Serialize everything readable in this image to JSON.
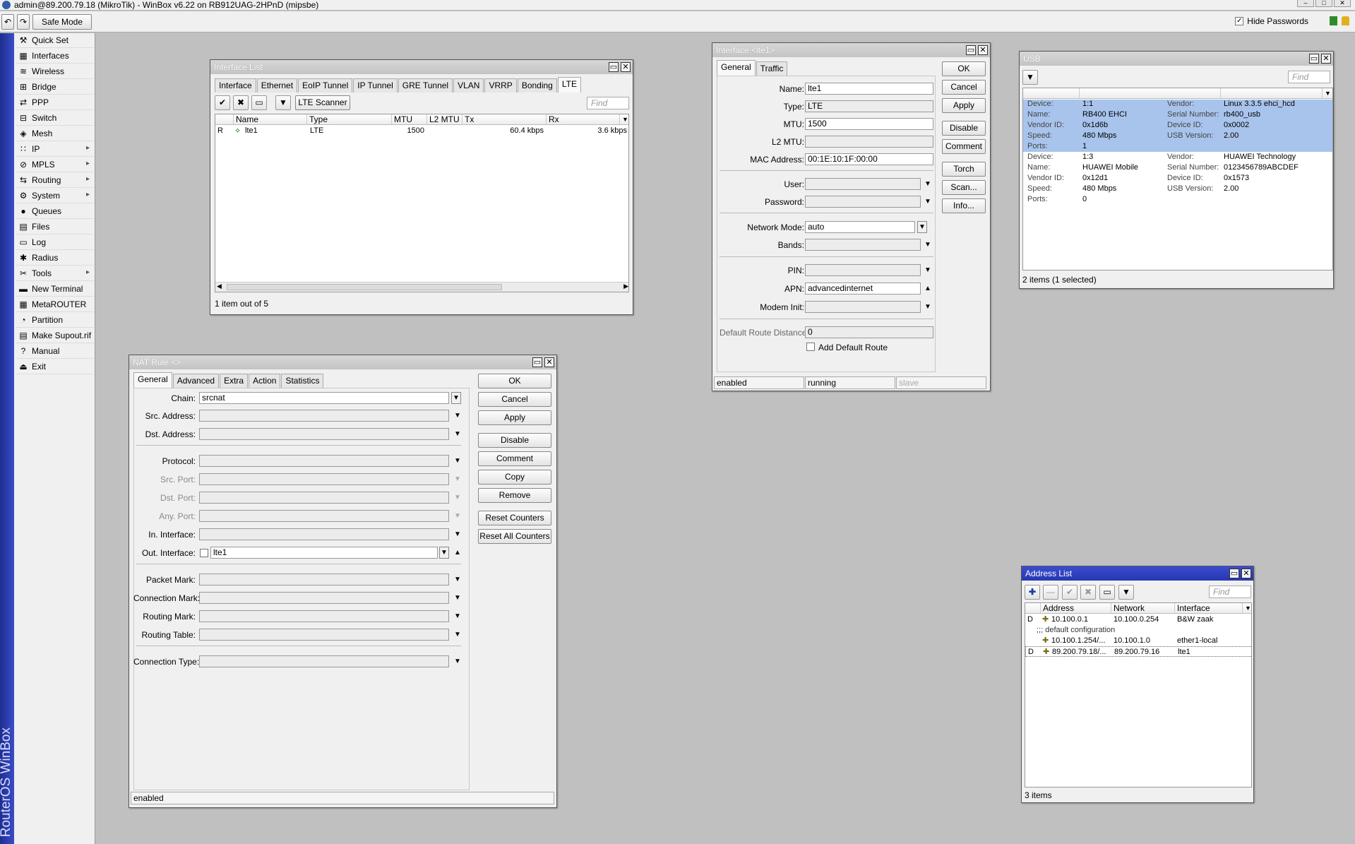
{
  "titlebar": {
    "title": "admin@89.200.79.18 (MikroTik) - WinBox v6.22 on RB912UAG-2HPnD (mipsbe)"
  },
  "toolbar": {
    "undo": "↶",
    "redo": "↷",
    "safe_mode": "Safe Mode",
    "hide_passwords": "Hide Passwords"
  },
  "vertical_brand": "RouterOS WinBox",
  "menu": [
    {
      "label": "Quick Set",
      "icon": "quick-set-icon",
      "glyph": "⚒",
      "sub": false
    },
    {
      "label": "Interfaces",
      "icon": "interfaces-icon",
      "glyph": "▦",
      "sub": false
    },
    {
      "label": "Wireless",
      "icon": "wireless-icon",
      "glyph": "≋",
      "sub": false
    },
    {
      "label": "Bridge",
      "icon": "bridge-icon",
      "glyph": "⊞",
      "sub": false
    },
    {
      "label": "PPP",
      "icon": "ppp-icon",
      "glyph": "⇄",
      "sub": false
    },
    {
      "label": "Switch",
      "icon": "switch-icon",
      "glyph": "⊟",
      "sub": false
    },
    {
      "label": "Mesh",
      "icon": "mesh-icon",
      "glyph": "◈",
      "sub": false
    },
    {
      "label": "IP",
      "icon": "ip-icon",
      "glyph": "∷",
      "sub": true
    },
    {
      "label": "MPLS",
      "icon": "mpls-icon",
      "glyph": "⊘",
      "sub": true
    },
    {
      "label": "Routing",
      "icon": "routing-icon",
      "glyph": "⇆",
      "sub": true
    },
    {
      "label": "System",
      "icon": "system-icon",
      "glyph": "⚙",
      "sub": true
    },
    {
      "label": "Queues",
      "icon": "queues-icon",
      "glyph": "●",
      "sub": false
    },
    {
      "label": "Files",
      "icon": "files-icon",
      "glyph": "▤",
      "sub": false
    },
    {
      "label": "Log",
      "icon": "log-icon",
      "glyph": "▭",
      "sub": false
    },
    {
      "label": "Radius",
      "icon": "radius-icon",
      "glyph": "✱",
      "sub": false
    },
    {
      "label": "Tools",
      "icon": "tools-icon",
      "glyph": "✂",
      "sub": true
    },
    {
      "label": "New Terminal",
      "icon": "terminal-icon",
      "glyph": "▬",
      "sub": false
    },
    {
      "label": "MetaROUTER",
      "icon": "metarouter-icon",
      "glyph": "▦",
      "sub": false
    },
    {
      "label": "Partition",
      "icon": "partition-icon",
      "glyph": "◔",
      "sub": false
    },
    {
      "label": "Make Supout.rif",
      "icon": "supout-icon",
      "glyph": "▤",
      "sub": false
    },
    {
      "label": "Manual",
      "icon": "manual-icon",
      "glyph": "?",
      "sub": false
    },
    {
      "label": "Exit",
      "icon": "exit-icon",
      "glyph": "⏏",
      "sub": false
    }
  ],
  "iflist": {
    "title": "Interface List",
    "tabs": [
      "Interface",
      "Ethernet",
      "EoIP Tunnel",
      "IP Tunnel",
      "GRE Tunnel",
      "VLAN",
      "VRRP",
      "Bonding",
      "LTE"
    ],
    "lte_scanner": "LTE Scanner",
    "find": "Find",
    "columns": [
      "Name",
      "Type",
      "MTU",
      "L2 MTU",
      "Tx",
      "Rx"
    ],
    "rows": [
      {
        "flag": "R",
        "name": "lte1",
        "type": "LTE",
        "mtu": "1500",
        "l2mtu": "",
        "tx": "60.4 kbps",
        "rx": "3.6 kbps"
      }
    ],
    "status": "1 item out of 5"
  },
  "ifwin": {
    "title": "Interface <lte1>",
    "tabs": [
      "General",
      "Traffic"
    ],
    "labels": {
      "name": "Name:",
      "type": "Type:",
      "mtu": "MTU:",
      "l2mtu": "L2 MTU:",
      "mac": "MAC Address:",
      "user": "User:",
      "password": "Password:",
      "netmode": "Network Mode:",
      "bands": "Bands:",
      "pin": "PIN:",
      "apn": "APN:",
      "modem": "Modem Init:",
      "drd": "Default Route Distance:",
      "adr": "Add Default Route"
    },
    "values": {
      "name": "lte1",
      "type": "LTE",
      "mtu": "1500",
      "l2mtu": "",
      "mac": "00:1E:10:1F:00:00",
      "user": "",
      "password": "",
      "netmode": "auto",
      "bands": "",
      "pin": "",
      "apn": "advancedinternet",
      "modem": "",
      "drd": "0"
    },
    "buttons": [
      "OK",
      "Cancel",
      "Apply",
      "Disable",
      "Comment",
      "Torch",
      "Scan...",
      "Info..."
    ],
    "status": [
      "enabled",
      "running",
      "slave"
    ]
  },
  "usb": {
    "title": "USB",
    "find": "Find",
    "devices": [
      {
        "selected": true,
        "device": "1:1",
        "name": "RB400 EHCI",
        "vendor_id": "0x1d6b",
        "speed": "480 Mbps",
        "ports": "1",
        "vendor": "Linux 3.3.5 ehci_hcd",
        "serial": "rb400_usb",
        "device_id": "0x0002",
        "usb_version": "2.00"
      },
      {
        "selected": false,
        "device": "1:3",
        "name": "HUAWEI Mobile",
        "vendor_id": "0x12d1",
        "speed": "480 Mbps",
        "ports": "0",
        "vendor": "HUAWEI Technology",
        "serial": "0123456789ABCDEF",
        "device_id": "0x1573",
        "usb_version": "2.00"
      }
    ],
    "keys": {
      "device": "Device:",
      "name": "Name:",
      "vendor_id": "Vendor ID:",
      "speed": "Speed:",
      "ports": "Ports:",
      "vendor": "Vendor:",
      "serial": "Serial Number:",
      "device_id": "Device ID:",
      "usb_version": "USB Version:"
    },
    "status": "2 items (1 selected)"
  },
  "nat": {
    "title": "NAT Rule <>",
    "tabs": [
      "General",
      "Advanced",
      "Extra",
      "Action",
      "Statistics"
    ],
    "fields": [
      {
        "label": "Chain:",
        "value": "srcnat",
        "dis": false,
        "kind": "select"
      },
      {
        "label": "Src. Address:",
        "value": "",
        "dis": false,
        "kind": "dd"
      },
      {
        "label": "Dst. Address:",
        "value": "",
        "dis": false,
        "kind": "dd"
      },
      {
        "label": "Protocol:",
        "value": "",
        "dis": false,
        "kind": "dd"
      },
      {
        "label": "Src. Port:",
        "value": "",
        "dis": true,
        "kind": "dd"
      },
      {
        "label": "Dst. Port:",
        "value": "",
        "dis": true,
        "kind": "dd"
      },
      {
        "label": "Any. Port:",
        "value": "",
        "dis": true,
        "kind": "dd"
      },
      {
        "label": "In. Interface:",
        "value": "",
        "dis": false,
        "kind": "dd"
      },
      {
        "label": "Out. Interface:",
        "value": "lte1",
        "dis": false,
        "kind": "out"
      },
      {
        "label": "Packet Mark:",
        "value": "",
        "dis": false,
        "kind": "dd"
      },
      {
        "label": "Connection Mark:",
        "value": "",
        "dis": false,
        "kind": "dd"
      },
      {
        "label": "Routing Mark:",
        "value": "",
        "dis": false,
        "kind": "dd"
      },
      {
        "label": "Routing Table:",
        "value": "",
        "dis": false,
        "kind": "dd"
      },
      {
        "label": "Connection Type:",
        "value": "",
        "dis": false,
        "kind": "dd"
      }
    ],
    "buttons": [
      "OK",
      "Cancel",
      "Apply",
      "Disable",
      "Comment",
      "Copy",
      "Remove",
      "Reset Counters",
      "Reset All Counters"
    ],
    "status": "enabled"
  },
  "addr": {
    "title": "Address List",
    "find": "Find",
    "columns": [
      "Address",
      "Network",
      "Interface"
    ],
    "rows": [
      {
        "flag": "D",
        "address": "10.100.0.1",
        "network": "10.100.0.254",
        "iface": "B&W zaak",
        "comment": false
      },
      {
        "flag": "",
        "address": ";;; default configuration",
        "network": "",
        "iface": "",
        "comment": true
      },
      {
        "flag": "",
        "address": "10.100.1.254/...",
        "network": "10.100.1.0",
        "iface": "ether1-local",
        "comment": false
      },
      {
        "flag": "D",
        "address": "89.200.79.18/...",
        "network": "89.200.79.16",
        "iface": "lte1",
        "comment": false
      }
    ],
    "status": "3 items"
  },
  "colors": {
    "accent": "#2737b0",
    "selection": "#a8c4ec",
    "brand_bar": "#2a3aa8"
  }
}
